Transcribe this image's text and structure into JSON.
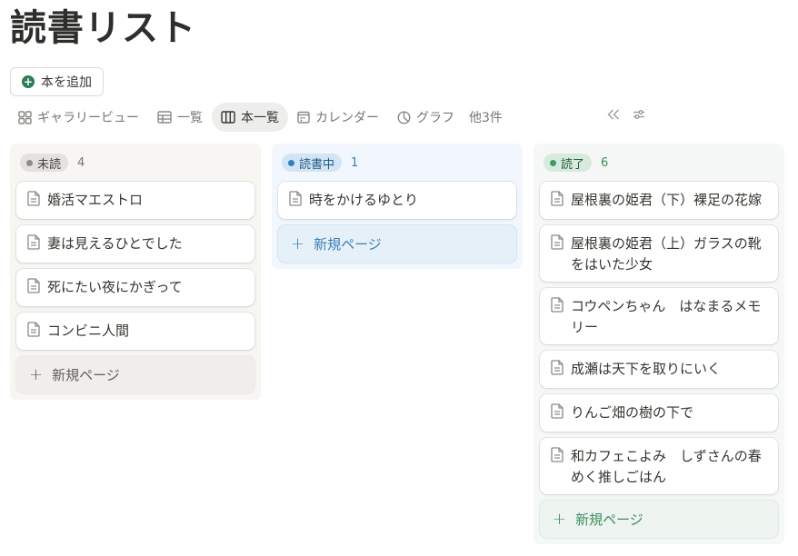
{
  "page": {
    "title": "読書リスト"
  },
  "toolbar": {
    "add_book_label": "本を追加"
  },
  "tabs": [
    {
      "label": "ギャラリービュー",
      "icon": "gallery-icon"
    },
    {
      "label": "一覧",
      "icon": "table-icon"
    },
    {
      "label": "本一覧",
      "icon": "board-icon",
      "active": true
    },
    {
      "label": "カレンダー",
      "icon": "calendar-icon"
    },
    {
      "label": "グラフ",
      "icon": "chart-icon"
    }
  ],
  "tabs_more": "他3件",
  "columns": [
    {
      "status": "未読",
      "count": "4",
      "color": "#8f8d89",
      "cards": [
        "婚活マエストロ",
        "妻は見えるひとでした",
        "死にたい夜にかぎって",
        "コンビニ人間"
      ],
      "new_page_label": "新規ページ"
    },
    {
      "status": "読書中",
      "count": "1",
      "color": "#2f7fc4",
      "cards": [
        "時をかけるゆとり"
      ],
      "new_page_label": "新規ページ"
    },
    {
      "status": "読了",
      "count": "6",
      "color": "#3a9c63",
      "cards": [
        "屋根裏の姫君（下）裸足の花嫁",
        "屋根裏の姫君（上）ガラスの靴をはいた少女",
        "コウペンちゃん　はなまるメモリー",
        "成瀬は天下を取りにいく",
        "りんご畑の樹の下で",
        "和カフェこよみ　しずさんの春めく推しごはん"
      ],
      "new_page_label": "新規ページ"
    }
  ]
}
